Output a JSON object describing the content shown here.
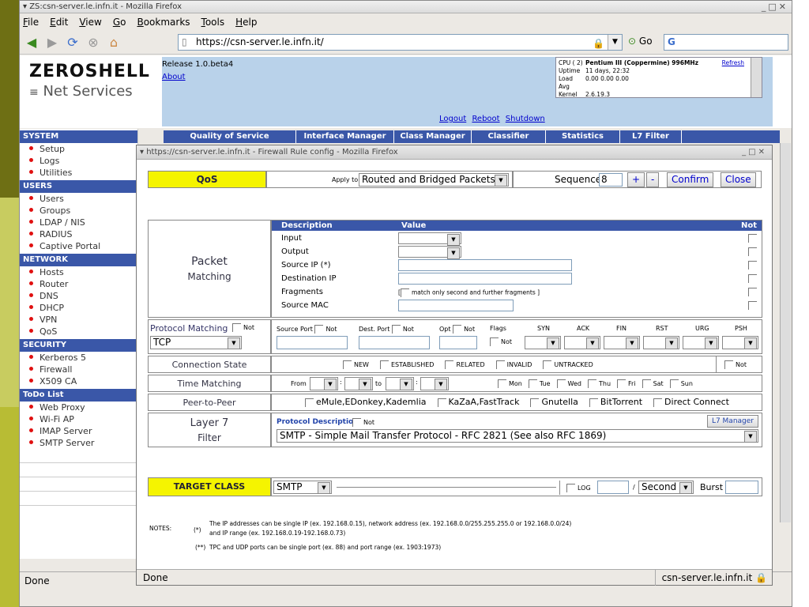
{
  "window": {
    "title": "ZS:csn-server.le.infn.it - Mozilla Firefox"
  },
  "menu": [
    {
      "key": "F",
      "rest": "ile"
    },
    {
      "key": "E",
      "rest": "dit"
    },
    {
      "key": "V",
      "rest": "iew"
    },
    {
      "key": "G",
      "rest": "o"
    },
    {
      "key": "B",
      "rest": "ookmarks"
    },
    {
      "key": "T",
      "rest": "ools"
    },
    {
      "key": "H",
      "rest": "elp"
    }
  ],
  "nav": {
    "url": "https://csn-server.le.infn.it/",
    "go_label": "Go",
    "search_text": "G"
  },
  "header": {
    "logo_top": "ZEROSHELL",
    "logo_bottom": "Net Services",
    "release": "Release 1.0.beta4",
    "about": "About",
    "logout": "Logout",
    "reboot": "Reboot",
    "shutdown": "Shutdown",
    "cpu_label": "CPU ( 2)",
    "cpu_value": "Pentium III (Coppermine) 996MHz",
    "uptime_label": "Uptime",
    "uptime_value": "11 days, 22:32",
    "load_label": "Load Avg",
    "load_value": "0.00 0.00 0.00",
    "kernel_label": "Kernel",
    "kernel_value": "2.6.19.3",
    "refresh": "Refresh"
  },
  "sidebar": [
    {
      "section": "SYSTEM",
      "items": [
        "Setup",
        "Logs",
        "Utilities"
      ]
    },
    {
      "section": "USERS",
      "items": [
        "Users",
        "Groups",
        "LDAP / NIS",
        "RADIUS",
        "Captive Portal"
      ]
    },
    {
      "section": "NETWORK",
      "items": [
        "Hosts",
        "Router",
        "DNS",
        "DHCP",
        "VPN",
        "QoS"
      ]
    },
    {
      "section": "SECURITY",
      "items": [
        "Kerberos 5",
        "Firewall",
        "X509 CA"
      ]
    },
    {
      "section": "ToDo List",
      "items": [
        "Web Proxy",
        "Wi-Fi AP",
        "IMAP Server",
        "SMTP Server"
      ]
    }
  ],
  "tabs": [
    "Quality of Service",
    "Interface Manager",
    "Class Manager",
    "Classifier",
    "Statistics",
    "L7 Filter"
  ],
  "popup": {
    "title": "https://csn-server.le.infn.it - Firewall Rule config - Mozilla Firefox",
    "qos_label": "QoS",
    "apply_to_label": "Apply to",
    "apply_to_value": "Routed and Bridged Packets",
    "sequence_label": "Sequence",
    "sequence_value": "8",
    "plus": "+",
    "minus": "-",
    "confirm": "Confirm",
    "close": "Close",
    "packet_label_1": "Packet",
    "packet_label_2": "Matching",
    "pm_header_desc": "Description",
    "pm_header_value": "Value",
    "pm_header_not": "Not",
    "pm_rows": [
      "Input",
      "Output",
      "Source IP (*)",
      "Destination IP",
      "Fragments",
      "Source MAC"
    ],
    "fragments_text": "match only second and further fragments",
    "protocol_matching": "Protocol Matching",
    "not": "Not",
    "protocol_value": "TCP",
    "source_port": "Source Port",
    "dest_port": "Dest. Port",
    "opt": "Opt",
    "flags": "Flags",
    "flag_names": [
      "SYN",
      "ACK",
      "FIN",
      "RST",
      "URG",
      "PSH"
    ],
    "conn_state_label": "Connection State",
    "conn_states": [
      "NEW",
      "ESTABLISHED",
      "RELATED",
      "INVALID",
      "UNTRACKED"
    ],
    "time_label": "Time Matching",
    "from": "From",
    "to": "to",
    "days": [
      "Mon",
      "Tue",
      "Wed",
      "Thu",
      "Fri",
      "Sat",
      "Sun"
    ],
    "p2p_label": "Peer-to-Peer",
    "p2p_items": [
      "eMule,EDonkey,Kademlia",
      "KaZaA,FastTrack",
      "Gnutella",
      "BitTorrent",
      "Direct Connect"
    ],
    "l7_label_1": "Layer 7",
    "l7_label_2": "Filter",
    "l7_desc_label": "Protocol Description",
    "l7_manager": "L7 Manager",
    "l7_value": "SMTP - Simple Mail Transfer Protocol - RFC 2821 (See also RFC 1869)",
    "target_label": "TARGET CLASS",
    "target_value": "SMTP",
    "log": "LOG",
    "per": "/",
    "rate_unit": "Second",
    "burst": "Burst",
    "notes_label": "NOTES:",
    "note1_mark": "(*)",
    "note1_line1": "The IP addresses can be single IP (ex. 192.168.0.15), network address (ex. 192.168.0.0/255.255.255.0 or 192.168.0.0/24)",
    "note1_line2": "and IP range (ex. 192.168.0.19-192.168.0.73)",
    "note2_mark": "(**)",
    "note2": "TPC and UDP ports can be single port (ex. 88) and port range (ex. 1903:1973)",
    "status": "Done",
    "host": "csn-server.le.infn.it"
  },
  "status": {
    "text": "Done"
  }
}
